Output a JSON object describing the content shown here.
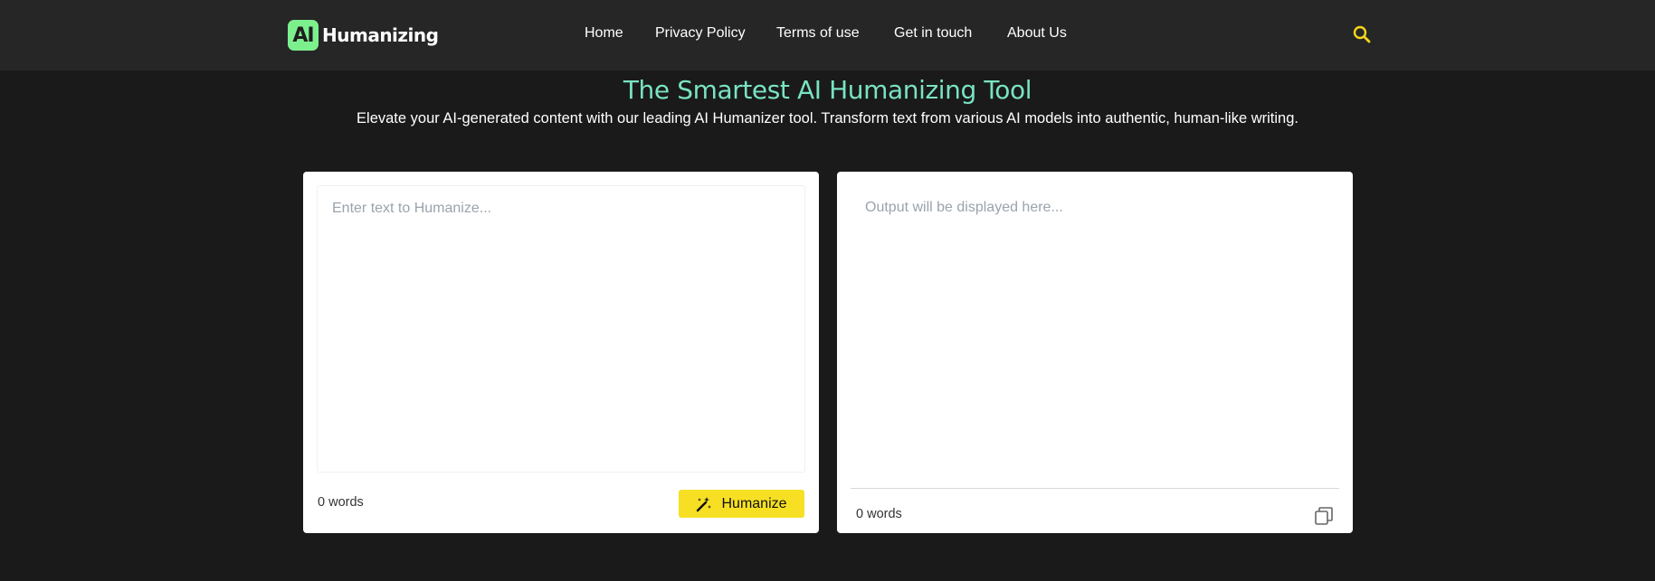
{
  "nav": {
    "logo_mark": "AI",
    "logo_text": "Humanizing",
    "links": [
      "Home",
      "Privacy Policy",
      "Terms of use",
      "Get in touch",
      "About Us"
    ],
    "search_icon": "search-icon"
  },
  "hero": {
    "title": "The Smartest AI Humanizing Tool",
    "subtitle": "Elevate your AI-generated content with our leading AI Humanizer tool. Transform text from various AI models into authentic, human-like writing."
  },
  "input_panel": {
    "placeholder": "Enter text to Humanize...",
    "word_count": "0 words",
    "button_label": "Humanize",
    "button_icon": "magic-wand-icon"
  },
  "output_panel": {
    "placeholder": "Output will be displayed here...",
    "word_count": "0 words",
    "copy_icon": "copy-icon"
  },
  "colors": {
    "background": "#1a1a1a",
    "navbar": "#262626",
    "accent_title": "#79e3c2",
    "button": "#f7e023",
    "search_icon": "#f5d51c"
  }
}
